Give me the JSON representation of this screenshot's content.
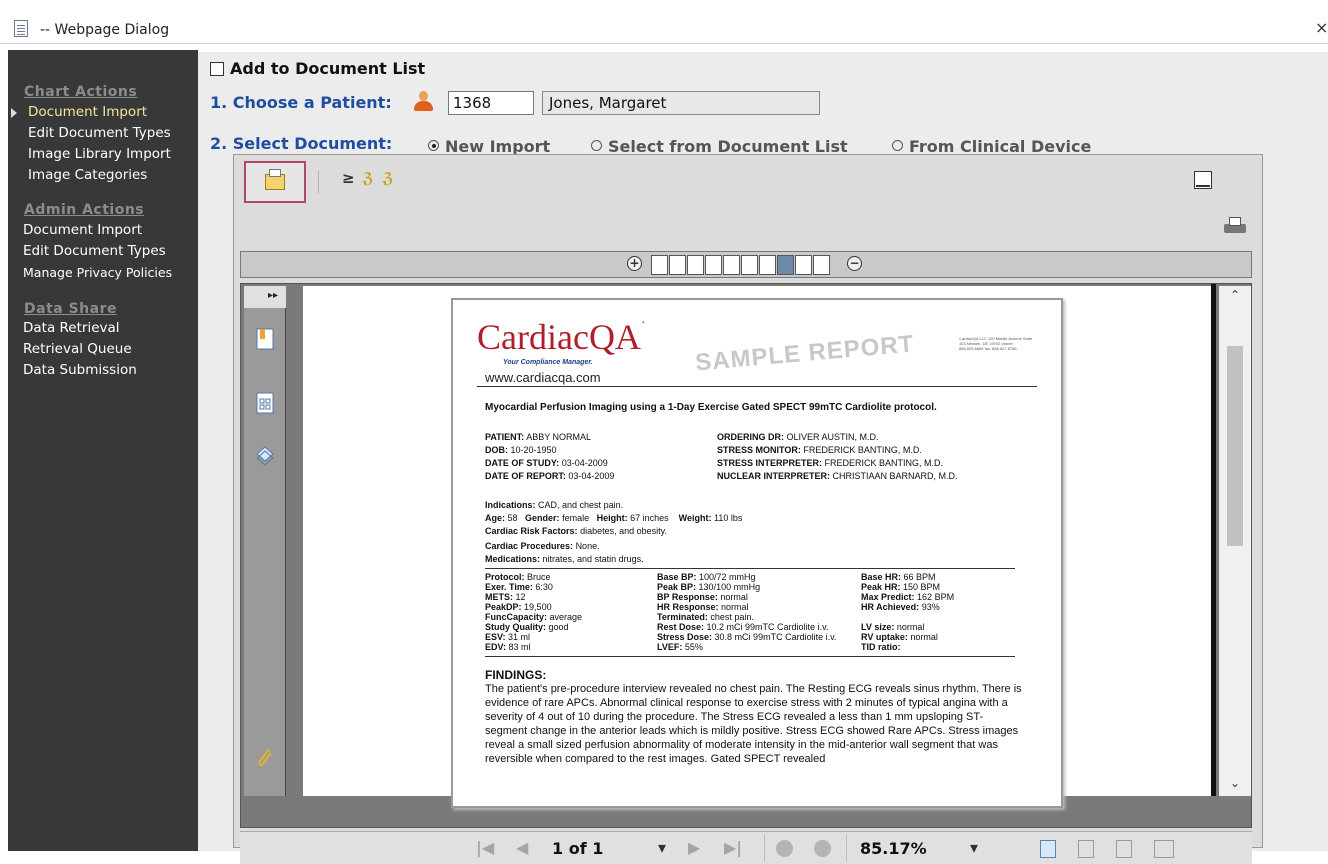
{
  "window": {
    "title": "-- Webpage Dialog",
    "close_symbol": "×"
  },
  "sidebar": {
    "chart_actions": {
      "header": "Chart Actions",
      "items": [
        "Document Import",
        "Edit Document Types",
        "Image Library Import",
        "Image Categories"
      ]
    },
    "admin_actions": {
      "header": "Admin Actions",
      "items": [
        "Document Import",
        "Edit Document Types",
        "Manage Privacy Policies"
      ]
    },
    "data_share": {
      "header": "Data Share",
      "items": [
        "Data Retrieval",
        "Retrieval Queue",
        "Data Submission"
      ]
    }
  },
  "form": {
    "add_to_list_label": "Add to Document List",
    "step1_label": "1. Choose a Patient:",
    "patient_id": "1368",
    "patient_name": "Jones, Margaret",
    "step2_label": "2. Select Document:",
    "options": [
      "New Import",
      "Select from Document List",
      "From Clinical Device"
    ],
    "selected_option": "New Import"
  },
  "viewer": {
    "page_indicator": "1 of 1",
    "zoom": "85.17%",
    "dropdown_symbol": "▾"
  },
  "document": {
    "brand": "CardiacQA",
    "brand_mark": "·",
    "tagline": "Your Compliance Manager.",
    "url": "www.cardiacqa.com",
    "watermark": "SAMPLE REPORT",
    "address": "CardiacQA LLC 100 Mobile Avenue Suite 103 Newark, DE 19702 phone: 866.625.6669 fax: 866.627.8766",
    "title": "Myocardial Perfusion Imaging using a 1-Day Exercise Gated SPECT 99mTC Cardiolite protocol.",
    "patient_info": [
      [
        "PATIENT:",
        "ABBY NORMAL"
      ],
      [
        "DOB:",
        "10-20-1950"
      ],
      [
        "DATE OF STUDY:",
        "03-04-2009"
      ],
      [
        "DATE OF REPORT:",
        "03-04-2009"
      ]
    ],
    "staff_info": [
      [
        "ORDERING DR:",
        "OLIVER AUSTIN, M.D."
      ],
      [
        "STRESS MONITOR:",
        "FREDERICK BANTING, M.D."
      ],
      [
        "STRESS INTERPRETER:",
        "FREDERICK BANTING, M.D."
      ],
      [
        "NUCLEAR INTERPRETER:",
        "CHRISTIAAN BARNARD, M.D."
      ]
    ],
    "clinical": [
      [
        "Indications:",
        "CAD, and chest pain."
      ],
      [
        "Age:",
        "58"
      ],
      [
        "Gender:",
        "female"
      ],
      [
        "Height:",
        "67 inches"
      ],
      [
        "Weight:",
        "110 lbs"
      ],
      [
        "Cardiac Risk Factors:",
        "diabetes, and obesity."
      ],
      [
        "Cardiac Procedures:",
        "None."
      ],
      [
        "Medications:",
        "nitrates, and statin drugs."
      ]
    ],
    "col1": [
      [
        "Protocol:",
        "Bruce"
      ],
      [
        "Exer. Time:",
        "6:30"
      ],
      [
        "METS:",
        "12"
      ],
      [
        "PeakDP:",
        "19,500"
      ],
      [
        "FuncCapacity:",
        "average"
      ],
      [
        "Study Quality:",
        "good"
      ],
      [
        "ESV:",
        "31 ml"
      ],
      [
        "EDV:",
        "83 ml"
      ]
    ],
    "col2": [
      [
        "Base BP:",
        "100/72 mmHg"
      ],
      [
        "Peak BP:",
        "130/100 mmHg"
      ],
      [
        "BP Response:",
        "normal"
      ],
      [
        "HR Response:",
        "normal"
      ],
      [
        "Terminated:",
        "chest pain."
      ],
      [
        "Rest Dose:",
        "10.2 mCi 99mTC Cardiolite i.v."
      ],
      [
        "Stress Dose:",
        "30.8 mCi 99mTC Cardiolite i.v."
      ],
      [
        "LVEF:",
        "55%"
      ]
    ],
    "col3": [
      [
        "Base HR:",
        "66 BPM"
      ],
      [
        "Peak HR:",
        "150 BPM"
      ],
      [
        "Max Predict:",
        "162 BPM"
      ],
      [
        "HR Achieved:",
        "93%"
      ],
      [
        "",
        ""
      ],
      [
        "LV size:",
        "normal"
      ],
      [
        "RV uptake:",
        "normal"
      ],
      [
        "TID ratio:",
        ""
      ]
    ],
    "findings_header": "FINDINGS:",
    "findings_text": "The patient's pre-procedure interview revealed no chest pain. The Resting ECG reveals sinus rhythm. There is evidence of rare APCs. Abnormal clinical response to exercise stress with 2 minutes of typical angina with a severity of 4 out of 10 during the procedure. The Stress ECG revealed a less than 1 mm upsloping ST-segment change in the anterior leads which is mildly positive. Stress ECG showed Rare APCs. Stress images reveal a small sized perfusion abnormality of moderate intensity in the mid-anterior wall segment that was reversible when compared to the rest images. Gated SPECT revealed"
  }
}
